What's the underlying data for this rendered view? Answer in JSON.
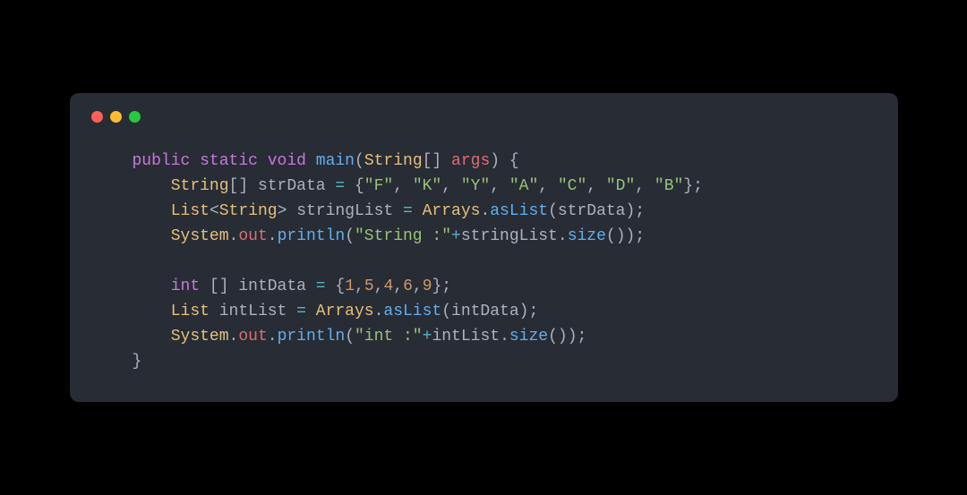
{
  "window": {
    "traffic": {
      "red": "#ff5f56",
      "yellow": "#ffbd2e",
      "green": "#27c93f"
    }
  },
  "code": {
    "line1": {
      "kw_public": "public",
      "kw_static": "static",
      "kw_void": "void",
      "method": "main",
      "paren_l": "(",
      "type1": "String",
      "brackets": "[]",
      "arg": "args",
      "paren_r": ")",
      "brace": " {"
    },
    "line2": {
      "indent": "    ",
      "type": "String",
      "brackets": "[]",
      "var": "strData",
      "eq": " = ",
      "brace_l": "{",
      "s1": "\"F\"",
      "c": ", ",
      "s2": "\"K\"",
      "s3": "\"Y\"",
      "s4": "\"A\"",
      "s5": "\"C\"",
      "s6": "\"D\"",
      "s7": "\"B\"",
      "brace_r": "};"
    },
    "line3": {
      "indent": "    ",
      "type1": "List",
      "lt": "<",
      "type2": "String",
      "gt": ">",
      "var": "stringList",
      "eq": " = ",
      "cls": "Arrays",
      "dot": ".",
      "method": "asList",
      "paren_l": "(",
      "arg": "strData",
      "paren_r": ");"
    },
    "line4": {
      "indent": "    ",
      "sys": "System",
      "dot1": ".",
      "out": "out",
      "dot2": ".",
      "method": "println",
      "paren_l": "(",
      "str": "\"String :\"",
      "plus": "+",
      "var": "stringList",
      "dot3": ".",
      "method2": "size",
      "paren_r": "());"
    },
    "line5": {
      "blank": ""
    },
    "line6": {
      "indent": "    ",
      "kw_int": "int",
      "brackets": " []",
      "var": "intData",
      "eq": " = ",
      "brace_l": "{",
      "n1": "1",
      "c": ",",
      "n2": "5",
      "n3": "4",
      "n4": "6",
      "n5": "9",
      "brace_r": "};"
    },
    "line7": {
      "indent": "    ",
      "type": "List",
      "var": "intList",
      "eq": " = ",
      "cls": "Arrays",
      "dot": ".",
      "method": "asList",
      "paren_l": "(",
      "arg": "intData",
      "paren_r": ");"
    },
    "line8": {
      "indent": "    ",
      "sys": "System",
      "dot1": ".",
      "out": "out",
      "dot2": ".",
      "method": "println",
      "paren_l": "(",
      "str": "\"int :\"",
      "plus": "+",
      "var": "intList",
      "dot3": ".",
      "method2": "size",
      "paren_r": "());"
    },
    "line9": {
      "brace": "}"
    }
  }
}
